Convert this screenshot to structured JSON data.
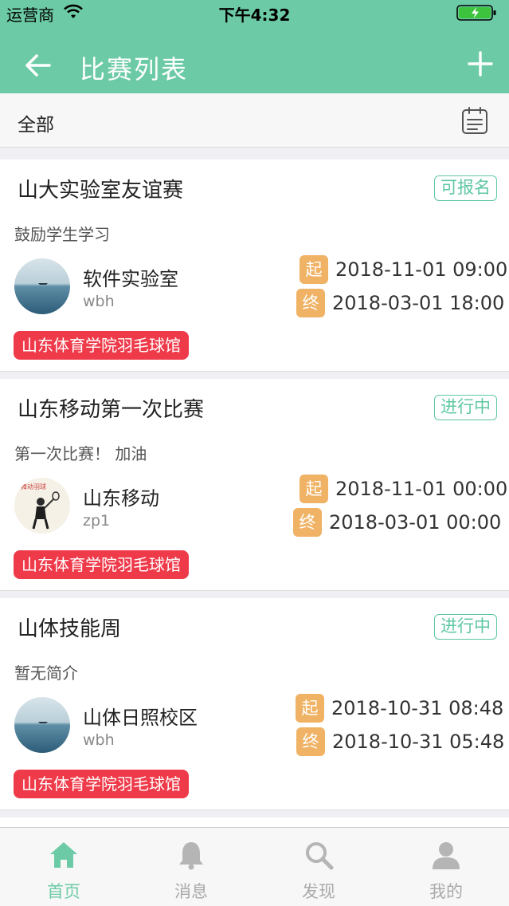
{
  "status_bar": {
    "carrier": "运营商",
    "time": "下午4:32"
  },
  "nav": {
    "title": "比赛列表",
    "back_icon": "arrow-left-icon",
    "add_icon": "plus-icon"
  },
  "filter": {
    "label": "全部",
    "calendar_icon": "calendar-icon"
  },
  "colors": {
    "brand": "#6ccba6",
    "status": "#5ec7a2",
    "time_tag": "#f0b264",
    "venue": "#ef3a4a"
  },
  "competitions": [
    {
      "title": "山大实验室友谊赛",
      "status": "可报名",
      "description": "鼓励学生学习",
      "organizer": "软件实验室",
      "user": "wbh",
      "start_label": "起",
      "start_time": "2018-11-01 09:00",
      "end_label": "终",
      "end_time": "2018-03-01 18:00",
      "venue": "山东体育学院羽毛球馆"
    },
    {
      "title": "山东移动第一次比赛",
      "status": "进行中",
      "description": "第一次比赛！ 加油",
      "organizer": "山东移动",
      "user": "zp1",
      "start_label": "起",
      "start_time": "2018-11-01 00:00",
      "end_label": "终",
      "end_time": "2018-03-01 00:00",
      "venue": "山东体育学院羽毛球馆"
    },
    {
      "title": "山体技能周",
      "status": "进行中",
      "description": "暂无简介",
      "organizer": "山体日照校区",
      "user": "wbh",
      "start_label": "起",
      "start_time": "2018-10-31 08:48",
      "end_label": "终",
      "end_time": "2018-10-31 05:48",
      "venue": "山东体育学院羽毛球馆"
    }
  ],
  "tabs": [
    {
      "label": "首页",
      "icon": "home-icon",
      "active": true
    },
    {
      "label": "消息",
      "icon": "bell-icon",
      "active": false
    },
    {
      "label": "发现",
      "icon": "search-icon",
      "active": false
    },
    {
      "label": "我的",
      "icon": "user-icon",
      "active": false
    }
  ]
}
